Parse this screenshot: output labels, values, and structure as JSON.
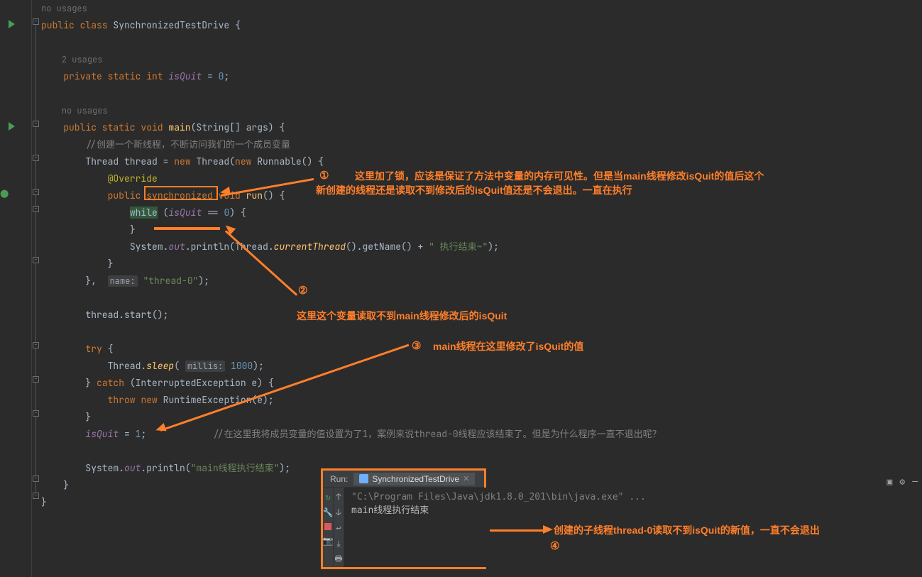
{
  "usages": {
    "class": "no usages",
    "field": "2 usages",
    "main": "no usages"
  },
  "code": {
    "class_decl_pre": "public class ",
    "class_name": "SynchronizedTestDrive",
    "class_decl_post": " {",
    "field_decl_pre": "private static int ",
    "field_name": "isQuit",
    "field_decl_post": " = ",
    "field_val": "0",
    "main_pre": "public static void ",
    "main_name": "main",
    "main_args": "(String[] args) {",
    "cmt_create_thread": "//创建一个新线程，不断访问我们的一个成员变量",
    "thread_decl": "Thread thread = ",
    "new_kw": "new",
    "thread_ctor": " Thread(",
    "runnable_ctor": " Runnable() {",
    "override": "@Override",
    "run_pre": "public ",
    "synchronized": "synchronized",
    "run_post": " void ",
    "run_name": "run",
    "run_paren": "() {",
    "while_kw": "while",
    "while_cond_pre": " (",
    "while_cond_post": " == ",
    "zero": "0",
    "while_end": ") {",
    "close_brace": "}",
    "sout": "System.",
    "out": "out",
    "println": ".println(Thread.",
    "currentThread": "currentThread",
    "getName": "().getName() + ",
    "exec_done_str": "\" 执行结束~\"",
    "close_paren": ");",
    "name_hint": "name:",
    "thread_name": "\"thread-0\"",
    "thread_start": "thread.start();",
    "try_kw": "try",
    "try_open": " {",
    "sleep_call_pre": "Thread.",
    "sleep_name": "sleep",
    "sleep_open": "( ",
    "millis_hint": "millis:",
    "sleep_ms": "1000",
    "sleep_close": ");",
    "catch_kw": "catch",
    "catch_args": " (InterruptedException e) {",
    "throw_kw": "throw",
    "rte": " RuntimeException(e);",
    "isquit_assign_post": " = ",
    "one": "1",
    "cmt_assign": "//在这里我将成员变量的值设置为了1，案例来说thread-0线程应该结束了。但是为什么程序一直不退出呢？",
    "main_done_str": "\"main线程执行结束\"",
    "sout_plain": "System.",
    "println_plain": ".println("
  },
  "annotations": {
    "num1": "①",
    "text1a": "这里加了锁，应该是保证了方法中变量的内存可见性。但是当main线程修改isQuit的值后这个",
    "text1b": "新创建的线程还是读取不到修改后的isQuit值还是不会退出。一直在执行",
    "num2": "②",
    "text2": "这里这个变量读取不到main线程修改后的isQuit",
    "num3": "③",
    "text3": "main线程在这里修改了isQuit的值",
    "num4": "④",
    "text4": "创建的子线程thread-0读取不到isQuit的新值，一直不会退出"
  },
  "run_panel": {
    "label": "Run:",
    "tab": "SynchronizedTestDrive",
    "out_line1": "\"C:\\Program Files\\Java\\jdk1.8.0_201\\bin\\java.exe\" ...",
    "out_line2": "main线程执行结束"
  },
  "colors": {
    "accent": "#ff7f2a",
    "bg": "#2b2b2b"
  }
}
